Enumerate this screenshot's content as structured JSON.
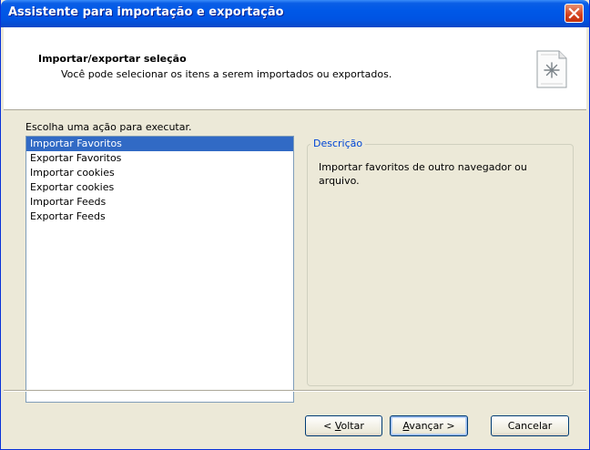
{
  "window": {
    "title": "Assistente para importação e exportação"
  },
  "header": {
    "title": "Importar/exportar seleção",
    "subtitle": "Você pode selecionar os itens a serem importados ou exportados."
  },
  "content": {
    "instruction": "Escolha uma ação para executar.",
    "actions": [
      "Importar Favoritos",
      "Exportar Favoritos",
      "Importar cookies",
      "Exportar cookies",
      "Importar Feeds",
      "Exportar Feeds"
    ],
    "selected_index": 0,
    "description_legend": "Descrição",
    "description_text": "Importar favoritos de outro navegador ou arquivo."
  },
  "buttons": {
    "back": {
      "prefix": "< ",
      "accel": "V",
      "rest": "oltar"
    },
    "next": {
      "accel": "A",
      "rest": "vançar >"
    },
    "cancel": "Cancelar"
  },
  "colors": {
    "titlebar": "#0054e3",
    "selection": "#316ac5",
    "legend": "#0046d5",
    "face": "#ece9d8"
  }
}
